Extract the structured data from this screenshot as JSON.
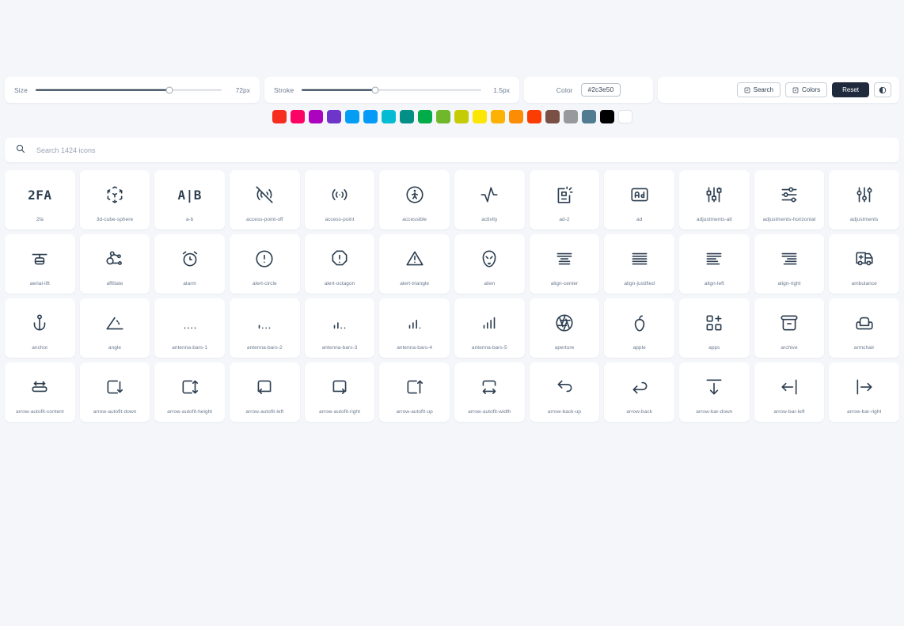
{
  "controls": {
    "size": {
      "label": "Size",
      "value": "72px",
      "percent": 72
    },
    "stroke": {
      "label": "Stroke",
      "value": "1.5px",
      "percent": 41
    },
    "color": {
      "label": "Color",
      "value": "#2c3e50"
    },
    "buttons": {
      "search": "Search",
      "colors": "Colors",
      "reset": "Reset"
    }
  },
  "swatches": [
    "#f72d1f",
    "#fc0366",
    "#ac03bf",
    "#6d35c9",
    "#039ef4",
    "#039bf7",
    "#03bcd4",
    "#038f85",
    "#02ad49",
    "#6fb72b",
    "#c6cc04",
    "#fbe703",
    "#fcb103",
    "#fb8c03",
    "#fb3d03",
    "#7b5044",
    "#97999a",
    "#507b91",
    "#000000",
    "#ffffff"
  ],
  "search": {
    "placeholder": "Search 1424 icons",
    "value": ""
  },
  "icons": [
    {
      "name": "2fa",
      "glyph": "2fa"
    },
    {
      "name": "3d-cube-sphere",
      "glyph": "3d-cube-sphere"
    },
    {
      "name": "a-b",
      "glyph": "a-b"
    },
    {
      "name": "access-point-off",
      "glyph": "access-point-off"
    },
    {
      "name": "access-point",
      "glyph": "access-point"
    },
    {
      "name": "accessible",
      "glyph": "accessible"
    },
    {
      "name": "activity",
      "glyph": "activity"
    },
    {
      "name": "ad-2",
      "glyph": "ad-2"
    },
    {
      "name": "ad",
      "glyph": "ad"
    },
    {
      "name": "adjustments-alt",
      "glyph": "adjustments-alt"
    },
    {
      "name": "adjustments-horizontal",
      "glyph": "adjustments-horizontal"
    },
    {
      "name": "adjustments",
      "glyph": "adjustments"
    },
    {
      "name": "aerial-lift",
      "glyph": "aerial-lift"
    },
    {
      "name": "affiliate",
      "glyph": "affiliate"
    },
    {
      "name": "alarm",
      "glyph": "alarm"
    },
    {
      "name": "alert-circle",
      "glyph": "alert-circle"
    },
    {
      "name": "alert-octagon",
      "glyph": "alert-octagon"
    },
    {
      "name": "alert-triangle",
      "glyph": "alert-triangle"
    },
    {
      "name": "alien",
      "glyph": "alien"
    },
    {
      "name": "align-center",
      "glyph": "align-center"
    },
    {
      "name": "align-justified",
      "glyph": "align-justified"
    },
    {
      "name": "align-left",
      "glyph": "align-left"
    },
    {
      "name": "align-right",
      "glyph": "align-right"
    },
    {
      "name": "ambulance",
      "glyph": "ambulance"
    },
    {
      "name": "anchor",
      "glyph": "anchor"
    },
    {
      "name": "angle",
      "glyph": "angle"
    },
    {
      "name": "antenna-bars-1",
      "glyph": "antenna-bars-1"
    },
    {
      "name": "antenna-bars-2",
      "glyph": "antenna-bars-2"
    },
    {
      "name": "antenna-bars-3",
      "glyph": "antenna-bars-3"
    },
    {
      "name": "antenna-bars-4",
      "glyph": "antenna-bars-4"
    },
    {
      "name": "antenna-bars-5",
      "glyph": "antenna-bars-5"
    },
    {
      "name": "aperture",
      "glyph": "aperture"
    },
    {
      "name": "apple",
      "glyph": "apple"
    },
    {
      "name": "apps",
      "glyph": "apps"
    },
    {
      "name": "archive",
      "glyph": "archive"
    },
    {
      "name": "armchair",
      "glyph": "armchair"
    },
    {
      "name": "arrow-autofit-content",
      "glyph": "arrow-autofit-content"
    },
    {
      "name": "arrow-autofit-down",
      "glyph": "arrow-autofit-down"
    },
    {
      "name": "arrow-autofit-height",
      "glyph": "arrow-autofit-height"
    },
    {
      "name": "arrow-autofit-left",
      "glyph": "arrow-autofit-left"
    },
    {
      "name": "arrow-autofit-right",
      "glyph": "arrow-autofit-right"
    },
    {
      "name": "arrow-autofit-up",
      "glyph": "arrow-autofit-up"
    },
    {
      "name": "arrow-autofit-width",
      "glyph": "arrow-autofit-width"
    },
    {
      "name": "arrow-back-up",
      "glyph": "arrow-back-up"
    },
    {
      "name": "arrow-back",
      "glyph": "arrow-back"
    },
    {
      "name": "arrow-bar-down",
      "glyph": "arrow-bar-down"
    },
    {
      "name": "arrow-bar-left",
      "glyph": "arrow-bar-left"
    },
    {
      "name": "arrow-bar-right",
      "glyph": "arrow-bar-right"
    }
  ]
}
